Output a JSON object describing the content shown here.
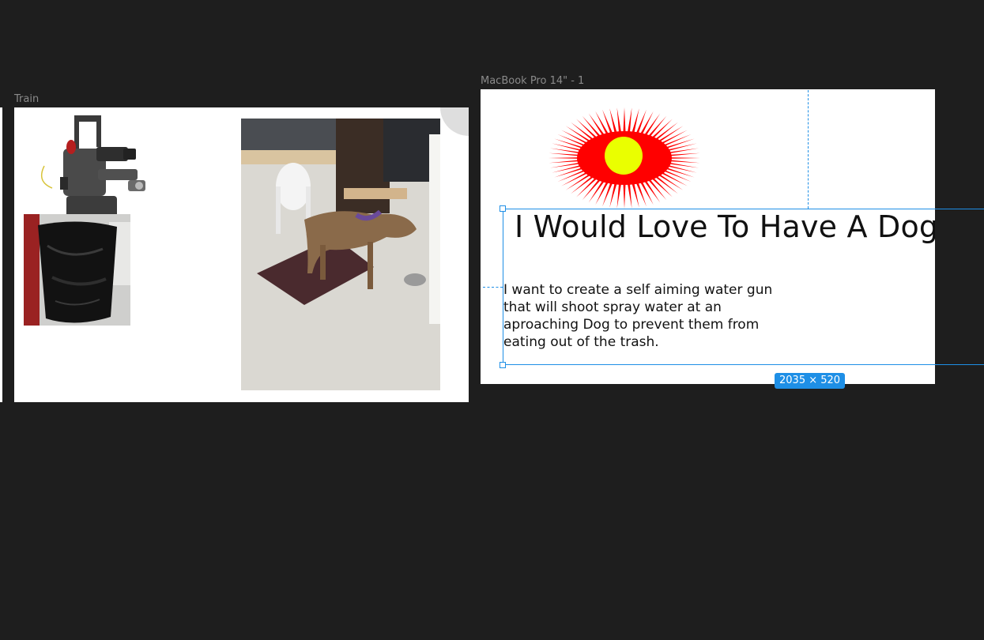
{
  "canvas": {
    "background": "#1e1e1e",
    "selection_color": "#1e8fe6"
  },
  "frames": {
    "train": {
      "label": "Train"
    },
    "macbook": {
      "label": "MacBook Pro 14\" - 1",
      "title": "I Would Love To Have A Dog",
      "body": "I want to create a self aiming water gun that will shoot spray water at an aproaching Dog to prevent them from eating out of the trash."
    }
  },
  "selection": {
    "dimensions": "2035 × 520"
  },
  "graphics": {
    "sun_ray_color": "#ff0000",
    "sun_center_color": "#eaff00"
  }
}
